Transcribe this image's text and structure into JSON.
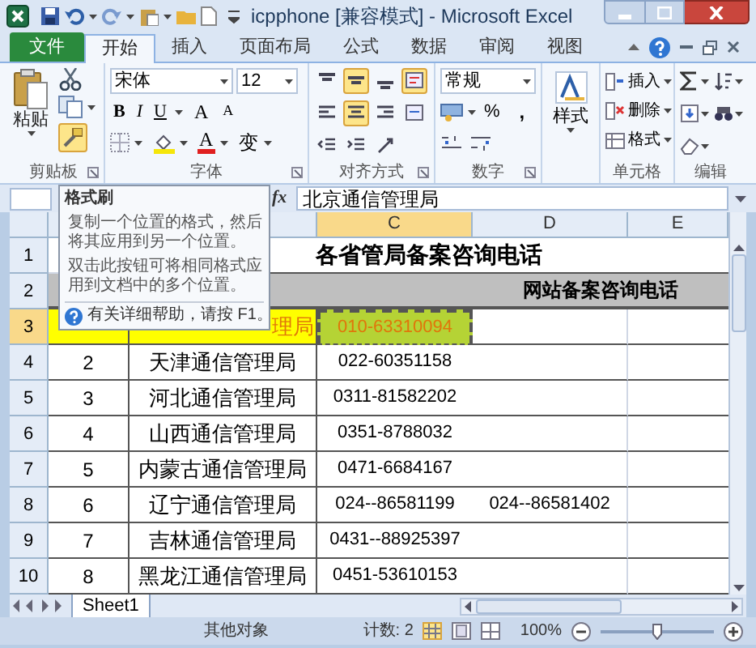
{
  "window": {
    "title": "icpphone  [兼容模式] - Microsoft Excel"
  },
  "tabs": [
    {
      "label": "文件",
      "kind": "file",
      "selected": false
    },
    {
      "label": "开始",
      "kind": "tab",
      "selected": true
    },
    {
      "label": "插入",
      "kind": "tab",
      "selected": false
    },
    {
      "label": "页面布局",
      "kind": "tab",
      "selected": false
    },
    {
      "label": "公式",
      "kind": "tab",
      "selected": false
    },
    {
      "label": "数据",
      "kind": "tab",
      "selected": false
    },
    {
      "label": "审阅",
      "kind": "tab",
      "selected": false
    },
    {
      "label": "视图",
      "kind": "tab",
      "selected": false
    }
  ],
  "ribbon": {
    "clipboard": {
      "label": "剪贴板",
      "paste": "粘贴",
      "format_painter_pressed": true
    },
    "font": {
      "label": "字体",
      "font_name": "宋体",
      "font_size": "12",
      "style_buttons": [
        "B",
        "I",
        "U"
      ],
      "size_buttons": [
        "A",
        "A"
      ],
      "font_color": "A",
      "phonetic": "变"
    },
    "alignment": {
      "label": "对齐方式",
      "buttons": [
        {
          "selected": false
        },
        {
          "selected": true
        },
        {
          "selected": false
        },
        {
          "selected": true
        },
        {
          "selected": false
        },
        {
          "selected": true
        },
        {
          "selected": false
        },
        {
          "selected": false
        },
        {
          "selected": false
        },
        {
          "selected": false
        },
        {
          "selected": false
        }
      ]
    },
    "number": {
      "label": "数字",
      "format": "常规",
      "percent": "%",
      "comma": ","
    },
    "styles": {
      "button": "样式"
    },
    "cells": {
      "label": "单元格",
      "buttons": [
        "插入",
        "删除",
        "格式"
      ]
    },
    "editing": {
      "label": "编辑"
    }
  },
  "formula_bar": {
    "function_label": "fx",
    "value": "北京通信管理局"
  },
  "columns": [
    {
      "label": "C",
      "selected": true
    },
    {
      "label": "D",
      "selected": false
    },
    {
      "label": "E",
      "selected": false
    }
  ],
  "sheet": {
    "title": "各省管局备案咨询电话",
    "header": "网站备案咨询电话",
    "rows": [
      {
        "row": "1",
        "selected": false
      },
      {
        "row": "2",
        "selected": false
      },
      {
        "row": "3",
        "selected": true,
        "column_2": "理局",
        "column_3": "010-63310094",
        "copied": true
      },
      {
        "row": "4",
        "selected": false,
        "column_1": "2",
        "column_2": "天津通信管理局",
        "column_3": "022-60351158"
      },
      {
        "row": "5",
        "selected": false,
        "column_1": "3",
        "column_2": "河北通信管理局",
        "column_3": "0311-81582202"
      },
      {
        "row": "6",
        "selected": false,
        "column_1": "4",
        "column_2": "山西通信管理局",
        "column_3": "0351-8788032"
      },
      {
        "row": "7",
        "selected": false,
        "column_1": "5",
        "column_2": "内蒙古通信管理局",
        "column_3": "0471-6684167"
      },
      {
        "row": "8",
        "selected": false,
        "column_1": "6",
        "column_2": "辽宁通信管理局",
        "column_3": "024--86581199",
        "column_4": "024--86581402"
      },
      {
        "row": "9",
        "selected": false,
        "column_1": "7",
        "column_2": "吉林通信管理局",
        "column_3": "0431--88925397"
      },
      {
        "row": "10",
        "selected": false,
        "column_1": "8",
        "column_2": "黑龙江通信管理局",
        "column_3": "0451-53610153"
      }
    ]
  },
  "tooltip": {
    "title": "格式刷",
    "paragraphs": [
      "复制一个位置的格式，然后将其应用到另一个位置。",
      "双击此按钮可将相同格式应用到文档中的多个位置。"
    ],
    "help": "有关详细帮助，请按 F1。"
  },
  "sheet_tabs": [
    {
      "label": "Sheet1",
      "selected": true
    }
  ],
  "status_bar": {
    "message": "其他对象",
    "count": "计数: 2",
    "zoom": "100%",
    "zoom_slider": {
      "level": 0.5
    }
  }
}
